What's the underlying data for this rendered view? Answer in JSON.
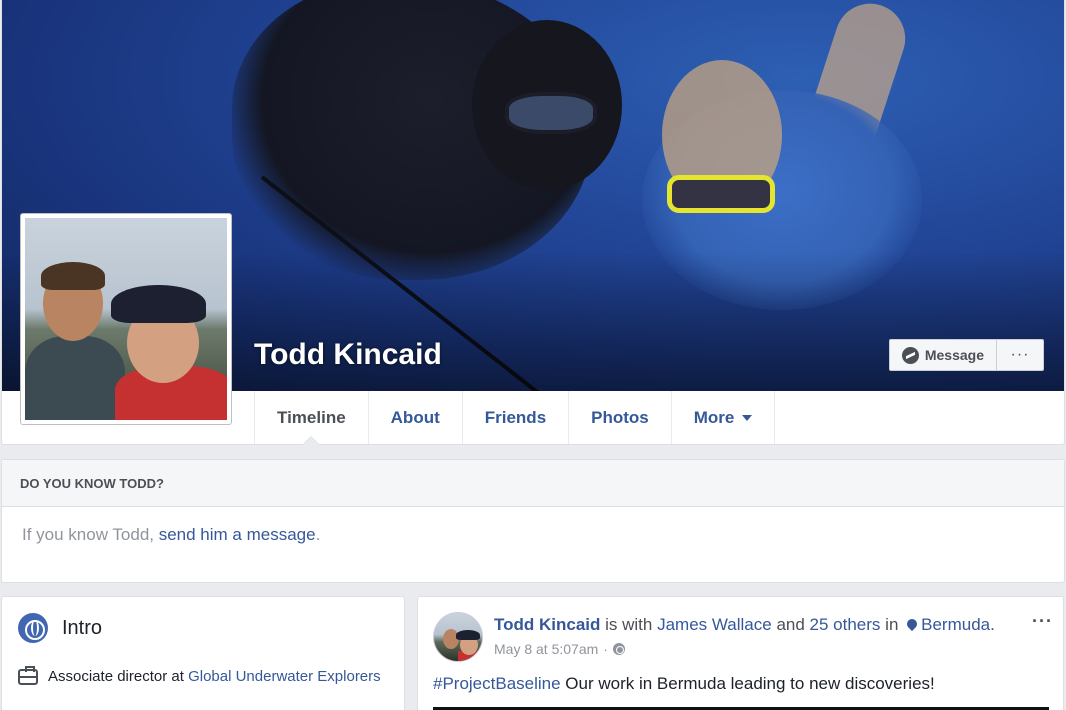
{
  "profile": {
    "name": "Todd Kincaid"
  },
  "cover_actions": {
    "message_label": "Message",
    "more_label": "···"
  },
  "tabs": [
    {
      "label": "Timeline",
      "active": true
    },
    {
      "label": "About"
    },
    {
      "label": "Friends"
    },
    {
      "label": "Photos"
    },
    {
      "label": "More"
    }
  ],
  "know_box": {
    "heading": "DO YOU KNOW TODD?",
    "text_prefix": "If you know Todd, ",
    "link_text": "send him a message",
    "text_suffix": "."
  },
  "intro": {
    "title": "Intro",
    "work_prefix": "Associate director at ",
    "work_link": "Global Underwater Explorers"
  },
  "post": {
    "author": "Todd Kincaid",
    "with_text": " is with ",
    "tagged": "James Wallace",
    "and_text": " and ",
    "others": "25 others",
    "in_text": " in ",
    "location": "Bermuda",
    "period": ".",
    "timestamp": "May 8 at 5:07am",
    "separator": "·",
    "hashtag": "#ProjectBaseline",
    "body": " Our work in Bermuda leading to new discoveries!",
    "menu_label": "···"
  },
  "colors": {
    "link": "#365899",
    "background": "#e9ebee",
    "brand": "#4267b2"
  }
}
